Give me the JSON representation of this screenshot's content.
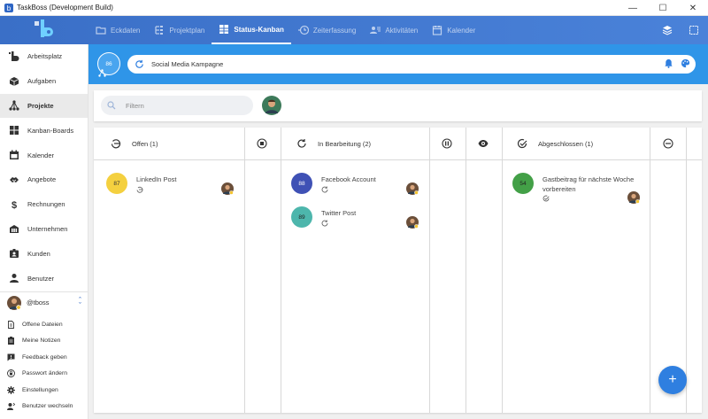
{
  "window": {
    "title": "TaskBoss (Development Build)",
    "controls": [
      "—",
      "☐",
      "✕"
    ]
  },
  "topnav": {
    "tabs": [
      {
        "label": "Eckdaten",
        "icon": "folder-icon",
        "active": false
      },
      {
        "label": "Projektplan",
        "icon": "tree-icon",
        "active": false
      },
      {
        "label": "Status-Kanban",
        "icon": "kanban-icon",
        "active": true
      },
      {
        "label": "Zeiterfassung",
        "icon": "clock-icon",
        "active": false
      },
      {
        "label": "Aktivitäten",
        "icon": "people-icon",
        "active": false
      },
      {
        "label": "Kalender",
        "icon": "calendar-icon",
        "active": false
      }
    ]
  },
  "sidebar": {
    "items": [
      {
        "label": "Arbeitsplatz",
        "icon": "brand-icon"
      },
      {
        "label": "Aufgaben",
        "icon": "cube-icon"
      },
      {
        "label": "Projekte",
        "icon": "network-icon",
        "active": true
      },
      {
        "label": "Kanban-Boards",
        "icon": "board-icon"
      },
      {
        "label": "Kalender",
        "icon": "calendar-icon"
      },
      {
        "label": "Angebote",
        "icon": "handshake-icon"
      },
      {
        "label": "Rechnungen",
        "icon": "dollar-icon"
      },
      {
        "label": "Unternehmen",
        "icon": "building-icon"
      },
      {
        "label": "Kunden",
        "icon": "id-badge-icon"
      },
      {
        "label": "Benutzer",
        "icon": "user-icon"
      }
    ],
    "user": "@tboss",
    "sub_items": [
      {
        "label": "Offene Dateien",
        "icon": "file-icon"
      },
      {
        "label": "Meine Notizen",
        "icon": "clipboard-icon"
      },
      {
        "label": "Feedback geben",
        "icon": "feedback-icon"
      },
      {
        "label": "Passwort ändern",
        "icon": "lock-icon"
      },
      {
        "label": "Einstellungen",
        "icon": "gear-icon"
      },
      {
        "label": "Benutzer wechseln",
        "icon": "switch-user-icon"
      }
    ]
  },
  "project": {
    "progress": "86",
    "name": "Social Media Kampagne"
  },
  "filter": {
    "placeholder": "Filtern"
  },
  "columns": [
    {
      "title": "Offen (1)",
      "icon": "undo-icon"
    },
    {
      "title": "In Bearbeitung (2)",
      "icon": "refresh-icon"
    },
    {
      "title": "Abgeschlossen (1)",
      "icon": "check-circle-icon"
    }
  ],
  "cards": [
    {
      "score": "87",
      "title": "LinkedIn Post",
      "color": "#f4d03f"
    },
    {
      "score": "88",
      "title": "Facebook Account",
      "color": "#3f51b5"
    },
    {
      "score": "89",
      "title": "Twitter Post",
      "color": "#4db6ac"
    },
    {
      "score": "54",
      "title_line1": "Gastbeitrag für nächste Woche",
      "title_line2": "vorbereiten",
      "color": "#43a047"
    }
  ],
  "fab": "+"
}
